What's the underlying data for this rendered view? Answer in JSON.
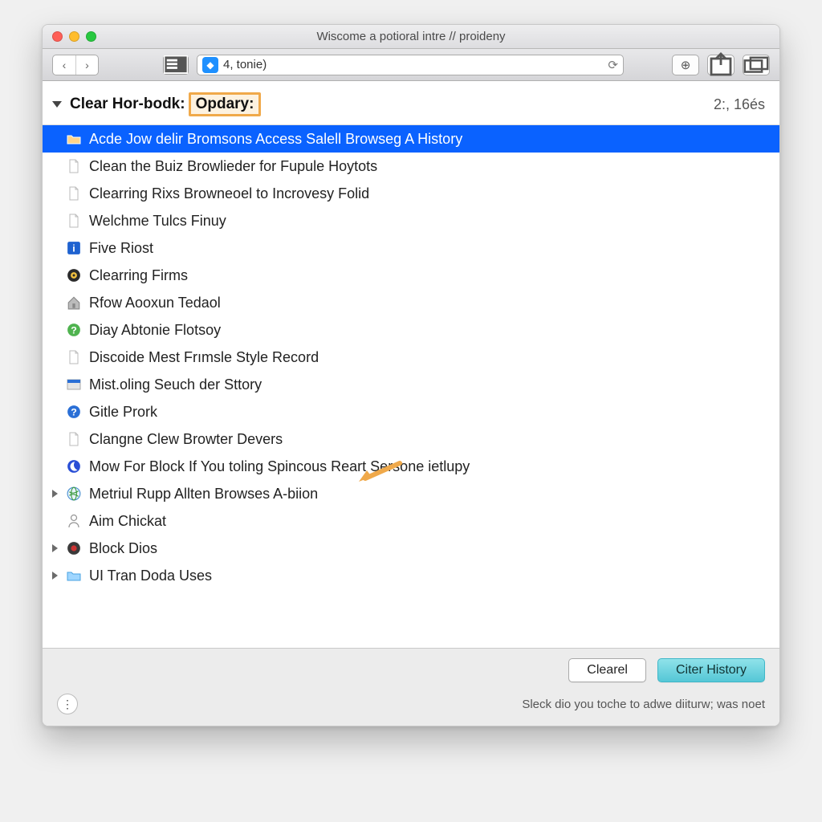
{
  "window": {
    "title": "Wiscome a potioral intre // proideny"
  },
  "toolbar": {
    "address": "4, tonie)"
  },
  "header": {
    "label": "Clear Hor-bodk:",
    "highlight": "Opdary:",
    "timestamp": "2:, 16és"
  },
  "items": [
    {
      "icon": "folder-orange",
      "label": "Acde Jow delir Bromsons Access Salell Browseg A History",
      "selected": true,
      "expandable": false
    },
    {
      "icon": "page",
      "label": "Clean the Buiz Browlieder for Fupule Hoytots",
      "selected": false
    },
    {
      "icon": "page",
      "label": "Clearring Rixs Browneoel to Incrovesy Folid",
      "selected": false
    },
    {
      "icon": "page-gray",
      "label": "Welchme Tulcs Finuy",
      "selected": false
    },
    {
      "icon": "info-blue",
      "label": "Five Riost",
      "selected": false
    },
    {
      "icon": "record-gold",
      "label": "Clearring Firms",
      "selected": false
    },
    {
      "icon": "home-gray",
      "label": "Rfow Aooxun Tedaol",
      "selected": false
    },
    {
      "icon": "help-green",
      "label": "Diay Abtonie Flotsoy",
      "selected": false
    },
    {
      "icon": "page",
      "label": "Discoide Mest Frımsle Style Record",
      "selected": false
    },
    {
      "icon": "bar-blue",
      "label": "Mist.oling Seuch der Sttory",
      "selected": false
    },
    {
      "icon": "help-blue",
      "label": "Gitle Prork",
      "selected": false
    },
    {
      "icon": "page",
      "label": "Clangne Clew Browter Devers",
      "selected": false
    },
    {
      "icon": "moon-blue",
      "label": "Mow For Block If You toling Spincous Reart Sersone ietlupy",
      "selected": false
    },
    {
      "icon": "globe-green",
      "label": "Metriul Rupp Allten Browses A-biion",
      "selected": false,
      "expandable": true
    },
    {
      "icon": "person-gray",
      "label": "Aim Chickat",
      "selected": false
    },
    {
      "icon": "record-red",
      "label": "Block Dios",
      "selected": false,
      "expandable": true
    },
    {
      "icon": "folder-blue",
      "label": "UI Tran Doda Uses",
      "selected": false,
      "expandable": true
    }
  ],
  "footer": {
    "clear": "Clearel",
    "primary": "Citer History",
    "status": "Sleck dio you toche to adwe diiturw; was noet"
  }
}
